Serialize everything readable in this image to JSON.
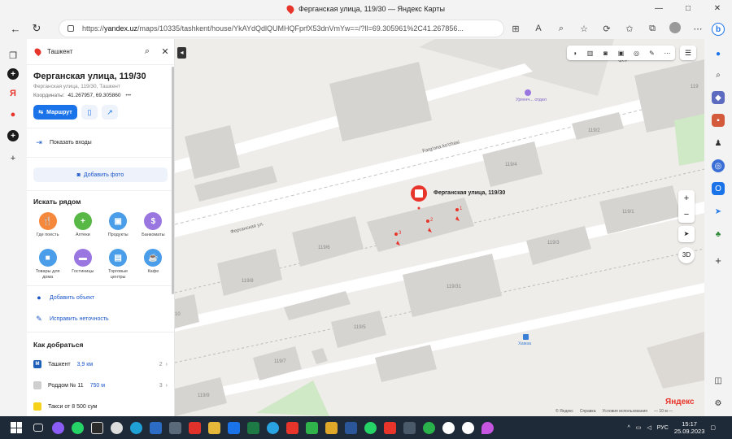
{
  "window": {
    "title": "Ферганская улица, 119/30 — Яндекс Карты",
    "controls": [
      "—",
      "□",
      "✕"
    ]
  },
  "browser": {
    "url_prefix": "https://",
    "url_host": "yandex.uz",
    "url_path": "/maps/10335/tashkent/house/YkAYdQdlQUMHQFprfX53dnVmYw==/?ll=69.305961%2C41.267856..."
  },
  "panel": {
    "search_query": "Ташкент",
    "address_title": "Ферганская улица, 119/30",
    "address_subtitle": "Ферганская улица, 119/30, Ташкент",
    "coords_label": "Координаты:",
    "coords_value": "41.267957, 69.305860",
    "coords_more": "•••",
    "route_button": "Маршрут",
    "show_entrances": "Показать входы",
    "add_photo": "Добавить фото",
    "nearby_title": "Искать рядом",
    "categories": [
      {
        "label": "Где поесть",
        "color": "#f5883b",
        "icon": "fork-knife-icon",
        "glyph": "🍴"
      },
      {
        "label": "Аптеки",
        "color": "#57b846",
        "icon": "pharmacy-cross-icon",
        "glyph": "+"
      },
      {
        "label": "Продукты",
        "color": "#4a9de8",
        "icon": "shopping-basket-icon",
        "glyph": "▣"
      },
      {
        "label": "Банкоматы",
        "color": "#9a77e0",
        "icon": "dollar-icon",
        "glyph": "$"
      },
      {
        "label": "Товары для дома",
        "color": "#4a9de8",
        "icon": "home-goods-icon",
        "glyph": "■"
      },
      {
        "label": "Гостиницы",
        "color": "#9a77e0",
        "icon": "bed-icon",
        "glyph": "▬"
      },
      {
        "label": "Торговые центры",
        "color": "#4a9de8",
        "icon": "mall-icon",
        "glyph": "▤"
      },
      {
        "label": "Кафе",
        "color": "#4a9de8",
        "icon": "coffee-cup-icon",
        "glyph": "☕"
      }
    ],
    "add_object": "Добавить объект",
    "fix_error": "Исправить неточность",
    "routes_title": "Как добраться",
    "routes": [
      {
        "name": "Ташкент",
        "dist": "3,9 км",
        "num": "2",
        "icon_color": "#1f5fb8",
        "icon_letter": "M"
      },
      {
        "name": "Роддом № 11",
        "dist": "750 м",
        "num": "3",
        "icon_color": "#cfcfcf",
        "icon_letter": ""
      },
      {
        "name": "Такси от 8 500 сум",
        "dist": "",
        "num": "",
        "icon_color": "#f7d21a",
        "icon_letter": ""
      }
    ]
  },
  "map": {
    "marker_label": "Ферганская улица, 119/30",
    "entrances": [
      "1",
      "2",
      "3"
    ],
    "street_labels": [
      "Farg'ona ko'chasi",
      "Ферганская ул."
    ],
    "poi_label": "Ургенч... отдел",
    "stop_label": "Хамза",
    "buildings": [
      "119/2",
      "119/4",
      "119/1",
      "119/3",
      "119/6",
      "119/8",
      "119/31",
      "119/5",
      "119/7",
      "119/9",
      "119",
      "10"
    ],
    "copyright": [
      "© Яндекс",
      "Справка",
      "Условия использования",
      "— 10 м —"
    ],
    "logo_main": "Яндекс",
    "btn_3d": "3D",
    "zoom_in": "+",
    "zoom_out": "−"
  },
  "taskbar": {
    "language": "РУС",
    "time": "15:17",
    "date": "25.09.2023"
  }
}
